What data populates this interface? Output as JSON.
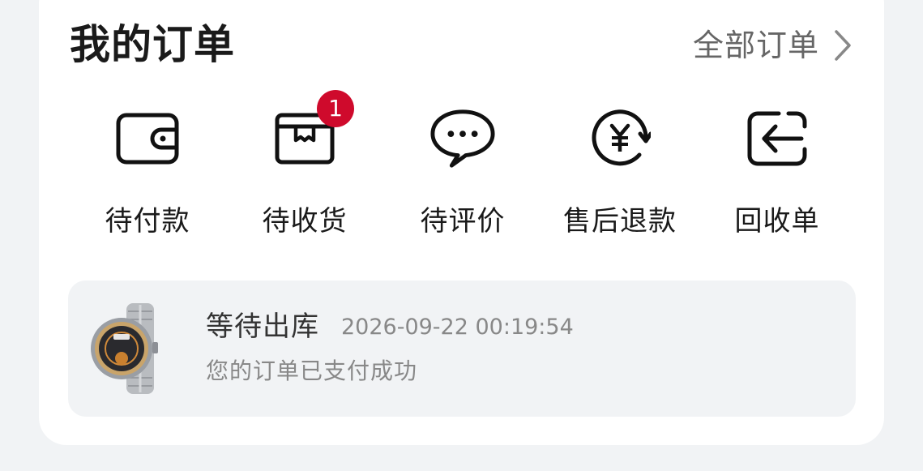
{
  "section": {
    "title": "我的订单",
    "all_orders_label": "全部订单",
    "chevron_icon": "chevron-right-icon"
  },
  "status_items": [
    {
      "label": "待付款",
      "icon": "wallet-icon"
    },
    {
      "label": "待收货",
      "icon": "package-icon",
      "badge": "1"
    },
    {
      "label": "待评价",
      "icon": "chat-bubble-icon"
    },
    {
      "label": "售后退款",
      "icon": "yuan-refund-icon"
    },
    {
      "label": "回收单",
      "icon": "return-arrow-icon"
    }
  ],
  "latest_order": {
    "status": "等待出库",
    "time": "2026-09-22 00:19:54",
    "message": "您的订单已支付成功",
    "image": "smartwatch-product-image"
  },
  "colors": {
    "badge": "#cf0a2c",
    "card_bg": "#ffffff",
    "page_bg": "#f1f3f5"
  }
}
